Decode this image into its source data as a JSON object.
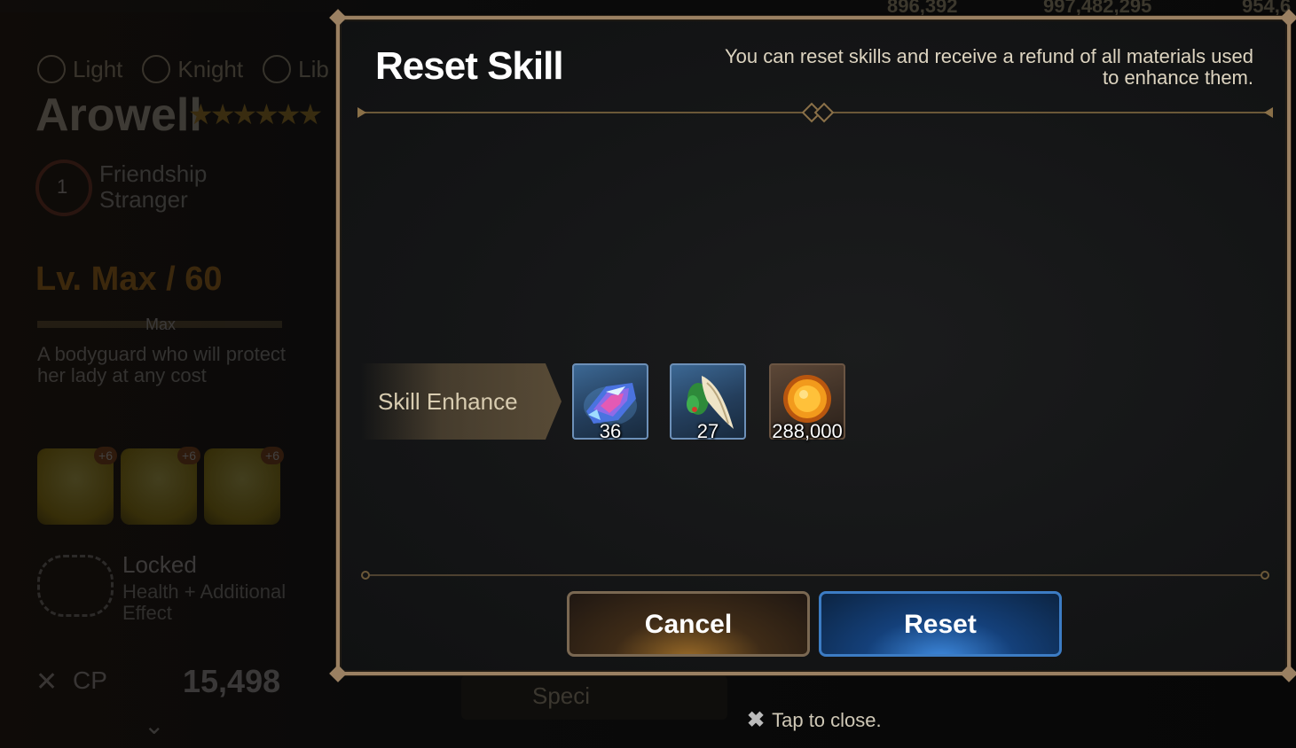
{
  "background": {
    "top_stats": [
      "896,392",
      "997,482,295",
      "954,6"
    ],
    "attributes": [
      "Light",
      "Knight",
      "Lib"
    ],
    "hero_name": "Arowell",
    "stars": "★★★★★★",
    "friendship": {
      "level": "1",
      "label": "Friendship",
      "status": "Stranger"
    },
    "level": "Lv. Max / 60",
    "max_label": "Max",
    "description": "A bodyguard who will protect her lady at any cost",
    "gear": [
      {
        "plus": "+6"
      },
      {
        "plus": "+6"
      },
      {
        "plus": "+6"
      }
    ],
    "locked": "Locked",
    "locked_desc": "Health + Additional Effect",
    "cp_label": "CP",
    "cp_value": "15,498",
    "special_button": "Speci"
  },
  "modal": {
    "title": "Reset Skill",
    "subtitle": "You can reset skills and receive a refund of all materials used to enhance them.",
    "section_label": "Skill Enhance",
    "items": [
      {
        "icon": "molagora-crystal-icon",
        "qty": "36"
      },
      {
        "icon": "molagora-root-icon",
        "qty": "27"
      },
      {
        "icon": "gold-coin-icon",
        "qty": "288,000"
      }
    ],
    "cancel_label": "Cancel",
    "reset_label": "Reset"
  },
  "footer": {
    "tap_close": "Tap to close."
  },
  "colors": {
    "frame": "#9a8062",
    "cancel_glow": "#9c6c28",
    "reset_glow": "#3f8be0",
    "overlay": "#050505"
  }
}
